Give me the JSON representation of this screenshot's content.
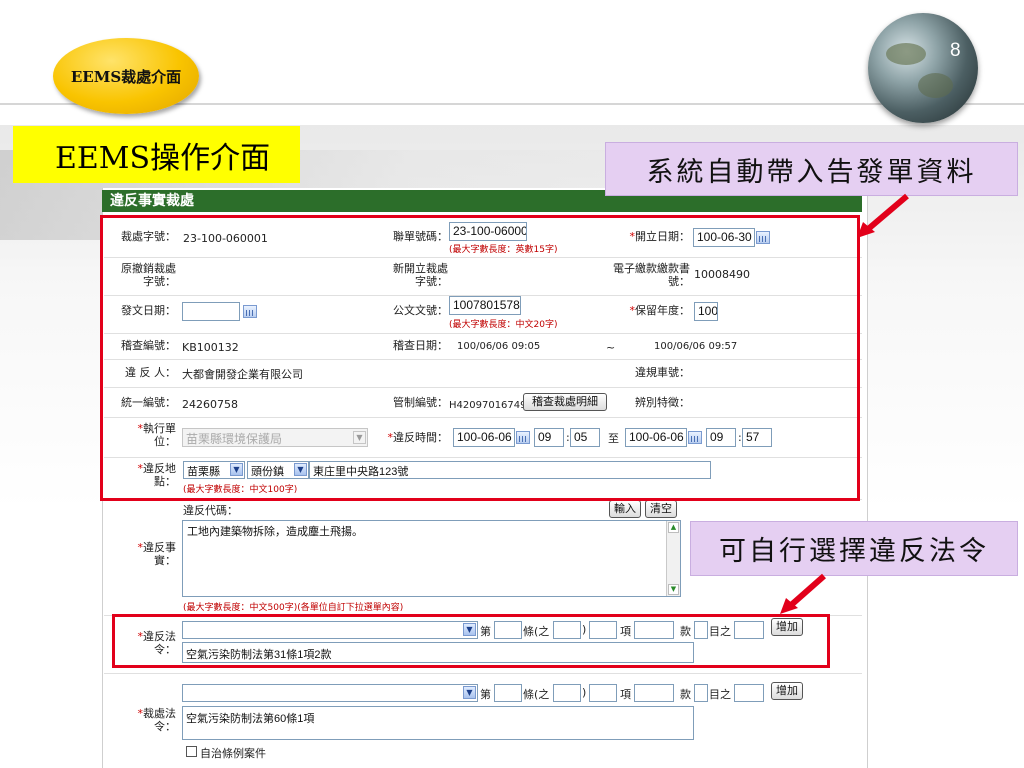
{
  "slide": {
    "badge": "EEMS裁處介面",
    "page_number": "8",
    "title": "EEMS操作介面",
    "callout_auto": "系統自動帶入告發單資料",
    "callout_select": "可自行選擇違反法令"
  },
  "form": {
    "header": "違反事實裁處",
    "case_no_label": "裁處字號：",
    "case_no_value": "23-100-060001",
    "joint_no_label": "聯單號碼：",
    "joint_no_value": "23-100-06000",
    "joint_no_hint": "(最大字數長度：英數15字)",
    "open_date_label": "開立日期：",
    "open_date_value": "100-06-30",
    "orig_case_label": "原撤銷裁處字號：",
    "new_case_label": "新開立裁處字號：",
    "e_pay_label": "電子繳款繳款書號：",
    "e_pay_value": "10008490",
    "issue_date_label": "發文日期：",
    "issue_date_value": "",
    "doc_no_label": "公文文號：",
    "doc_no_value": "1007801578",
    "doc_no_hint": "(最大字數長度：中文20字)",
    "retain_year_label": "保留年度：",
    "retain_year_value": "100",
    "inspect_no_label": "稽查編號：",
    "inspect_no_value": "KB100132",
    "inspect_date_label": "稽查日期：",
    "inspect_date_from": "100/06/06 09:05",
    "inspect_date_sep": "~",
    "inspect_date_to": "100/06/06 09:57",
    "violator_label": "違 反 人：",
    "violator_value": "大都會開發企業有限公司",
    "plate_label": "違規車號：",
    "plate_value": "",
    "unified_no_label": "統一編號：",
    "unified_no_value": "24260758",
    "control_no_label": "管制編號：",
    "control_no_value": "H42097016749",
    "detail_button": "稽查裁處明細",
    "feature_label": "辨別特徵：",
    "feature_value": "",
    "exec_unit_label": "執行單位：",
    "exec_unit_value": "苗栗縣環境保護局",
    "violation_time_label": "違反時間：",
    "vt_from_date": "100-06-06",
    "vt_from_hour": "09",
    "vt_from_min": "05",
    "vt_to_label": "至",
    "vt_to_date": "100-06-06",
    "vt_to_hour": "09",
    "vt_to_min": "57",
    "time_sep": ":",
    "location_label": "違反地點：",
    "county_value": "苗栗縣",
    "town_value": "頭份鎮",
    "address_value": "東庄里中央路123號",
    "location_hint": "(最大字數長度：中文100字)",
    "code_label": "違反代碼：",
    "input_button": "輸入",
    "clear_button": "清空",
    "fact_label": "違反事實：",
    "fact_value": "工地內建築物拆除，造成塵土飛揚。",
    "fact_hint": "(最大字數長度：中文500字)(各單位自訂下拉選單內容)",
    "law_label": "違反法令：",
    "law_article_text": "第",
    "law_article_paren_open": "條(之",
    "law_article_paren_close": ")",
    "law_item_text": "項",
    "law_subsection_text": "款",
    "law_point_text": "目之",
    "law_add_button": "增加",
    "law_value": "空氣污染防制法第31條1項2款",
    "penalty_label": "裁處法令：",
    "penalty_add_button": "增加",
    "penalty_value": "空氣污染防制法第60條1項",
    "self_rule_label": "自治條例案件",
    "required_mark": "*"
  }
}
